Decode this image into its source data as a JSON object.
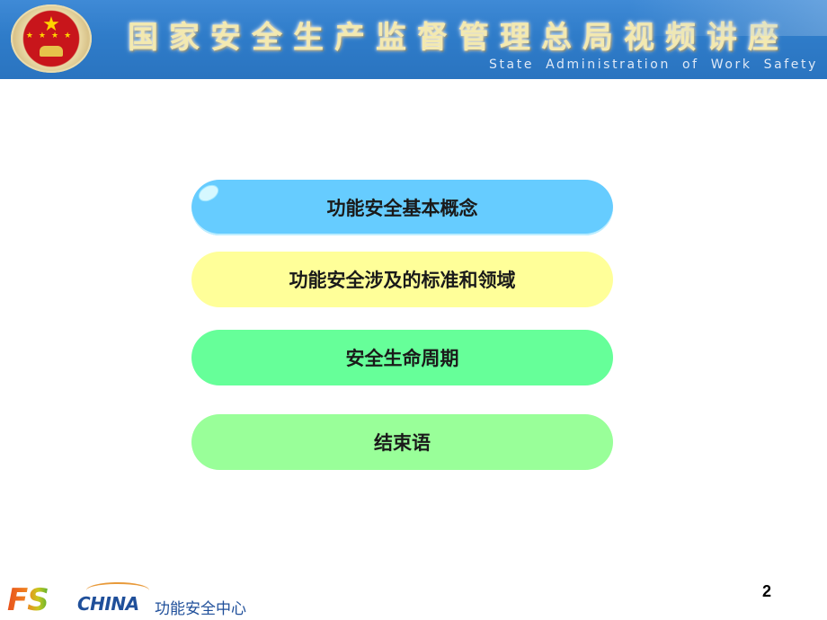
{
  "header": {
    "title": "国家安全生产监督管理总局视频讲座",
    "subtitle": "State Administration of Work Safety",
    "emblem_icon": "national-safety-emblem"
  },
  "menu": {
    "items": [
      {
        "label": "功能安全基本概念",
        "color": "#66ccff"
      },
      {
        "label": "功能安全涉及的标准和领域",
        "color": "#ffff99"
      },
      {
        "label": "安全生命周期",
        "color": "#66ff99"
      },
      {
        "label": "结束语",
        "color": "#99ff99"
      }
    ]
  },
  "footer": {
    "logo_fs": "FS",
    "logo_china": "CHINA",
    "logo_caption": "功能安全中心",
    "page_number": "2"
  }
}
